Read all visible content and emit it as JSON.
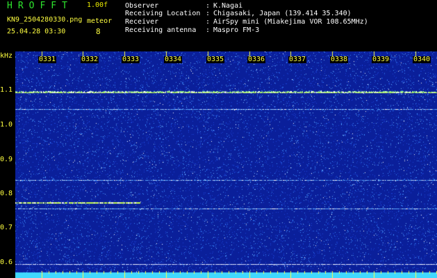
{
  "header": {
    "app_name": "HROFFT",
    "version": "1.00f",
    "filename": "KN9_2504280330.png",
    "datetime": "25.04.28 03:30",
    "meteor_label": "meteor",
    "meteor_count": "8"
  },
  "info": [
    {
      "label": "Observer",
      "value": "K.Nagai"
    },
    {
      "label": "Receiving Location",
      "value": "Chigasaki, Japan (139.414 35.340)"
    },
    {
      "label": "Receiver",
      "value": "AirSpy mini (Miakejima VOR 108.65MHz)"
    },
    {
      "label": "Receiving antenna",
      "value": "Maspro FM-3"
    }
  ],
  "spectrogram": {
    "y_unit": "kHz",
    "y_ticks": [
      "1.1",
      "1.0",
      "0.9",
      "0.8",
      "0.7",
      "0.6"
    ],
    "x_ticks": [
      "0331",
      "0332",
      "0333",
      "0334",
      "0335",
      "0336",
      "0337",
      "0338",
      "0339",
      "0340"
    ],
    "colors": {
      "background": "#0a1f9a",
      "noise": "#3a8cff",
      "signal": "#c8ff50",
      "floor": "#40d8ff"
    }
  }
}
